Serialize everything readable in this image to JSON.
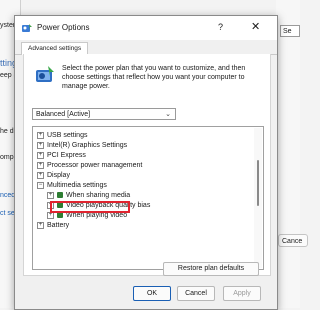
{
  "background": {
    "left_fragments": [
      "ystem",
      "tting",
      "eep a",
      "he di",
      "ompu",
      "nced",
      "ct set"
    ],
    "right_fragments": [
      "Se",
      "Cance"
    ]
  },
  "dialog": {
    "title": "Power Options",
    "help_glyph": "?",
    "close_glyph": "✕",
    "tab": "Advanced settings",
    "intro_text": "Select the power plan that you want to customize, and then choose settings that reflect how you want your computer to manage power.",
    "plan_select": "Balanced [Active]",
    "tree": [
      {
        "label": "USB settings",
        "expander": "+"
      },
      {
        "label": "Intel(R) Graphics Settings",
        "expander": "+"
      },
      {
        "label": "PCI Express",
        "expander": "+"
      },
      {
        "label": "Processor power management",
        "expander": "+"
      },
      {
        "label": "Display",
        "expander": "+"
      },
      {
        "label": "Multimedia settings",
        "expander": "−"
      },
      {
        "label": "When sharing media",
        "expander": "+"
      },
      {
        "label": "Video playback quality bias",
        "expander": "+"
      },
      {
        "label": "When playing video",
        "expander": "+"
      },
      {
        "label": "Battery",
        "expander": "+"
      }
    ],
    "restore_button": "Restore plan defaults",
    "ok_button": "OK",
    "cancel_button": "Cancel",
    "apply_button": "Apply"
  },
  "colors": {
    "highlight_box": "#e0242f",
    "ok_border": "#1a5fb4"
  }
}
